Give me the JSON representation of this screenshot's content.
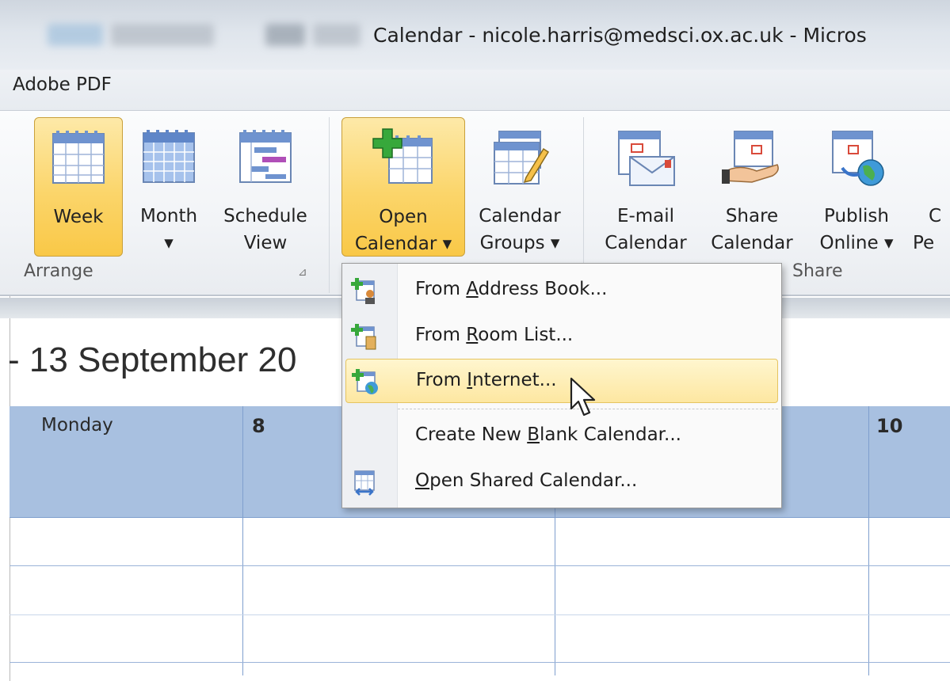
{
  "window": {
    "title": "Calendar - nicole.harris@medsci.ox.ac.uk - Micros"
  },
  "menu": {
    "item": "Adobe PDF"
  },
  "ribbon": {
    "arrange": {
      "label": "Arrange",
      "week": {
        "line1": "Week",
        "line2": ""
      },
      "month": {
        "line1": "Month",
        "line2": "▾"
      },
      "schedule": {
        "line1": "Schedule",
        "line2": "View"
      }
    },
    "manage": {
      "open_calendar": {
        "line1": "Open",
        "line2": "Calendar ▾"
      },
      "calendar_groups": {
        "line1": "Calendar",
        "line2": "Groups ▾"
      }
    },
    "share": {
      "label": "Share",
      "email": {
        "line1": "E-mail",
        "line2": "Calendar"
      },
      "share": {
        "line1": "Share",
        "line2": "Calendar"
      },
      "publish": {
        "line1": "Publish",
        "line2": "Online ▾"
      },
      "partial": {
        "line1": "C",
        "line2": "Pe"
      }
    }
  },
  "dropdown": {
    "items": [
      {
        "pre": "From ",
        "key": "A",
        "post": "ddress Book..."
      },
      {
        "pre": "From ",
        "key": "R",
        "post": "oom List..."
      },
      {
        "pre": "From ",
        "key": "I",
        "post": "nternet..."
      },
      {
        "pre": "Create New ",
        "key": "B",
        "post": "lank Calendar..."
      },
      {
        "pre": "",
        "key": "O",
        "post": "pen Shared Calendar..."
      }
    ]
  },
  "calendar": {
    "range_title": "- 13 September 20",
    "day_label": "Monday",
    "day_numbers": [
      "8",
      "10"
    ]
  },
  "colors": {
    "accent": "#fbd56a",
    "week_header": "#a8c0e0",
    "grid_line": "#7f9fce"
  }
}
